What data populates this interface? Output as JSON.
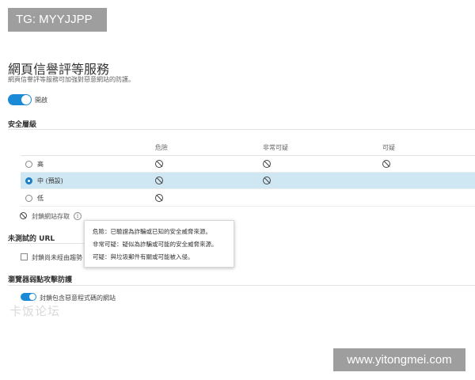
{
  "watermarks": {
    "top": "TG: MYYJJPP",
    "bottom": "www.yitongmei.com",
    "faint": "卡饭论坛"
  },
  "page": {
    "title": "網頁信譽評等服務",
    "subtitle": "網頁信譽評等服務可加強對惡意網站的防護。"
  },
  "main_toggle": {
    "label": "開啟",
    "state": "on"
  },
  "security_level": {
    "heading": "安全層級",
    "columns": [
      "危險",
      "非常可疑",
      "可疑"
    ],
    "rows": [
      {
        "label": "高",
        "selected": false,
        "blocks": [
          true,
          true,
          true
        ]
      },
      {
        "label": "中 (預設)",
        "selected": true,
        "blocks": [
          true,
          true,
          false
        ]
      },
      {
        "label": "低",
        "selected": false,
        "blocks": [
          true,
          false,
          false
        ]
      }
    ],
    "legend_label": "封鎖網站存取",
    "legend_icon": "block-icon",
    "info_icon": "i"
  },
  "tooltip": {
    "lines": [
      "危險：已驗證為詐騙或已知的安全威脅來源。",
      "非常可疑：疑似為詐騙或可能的安全威脅來源。",
      "可疑：與垃圾郵件有關或可能被入侵。"
    ]
  },
  "untested_url": {
    "heading": "未測試的 URL",
    "checkbox_label": "封鎖尚未經由趨勢",
    "checked": false
  },
  "browser_exploit": {
    "heading": "瀏覽器弱點攻擊防護",
    "toggle_label": "封鎖包含惡意程式碼的網站",
    "state": "on"
  },
  "colors": {
    "accent": "#1a8ad6",
    "selected_row": "#cfe7f2",
    "watermark_bg": "#9e9e9e"
  }
}
